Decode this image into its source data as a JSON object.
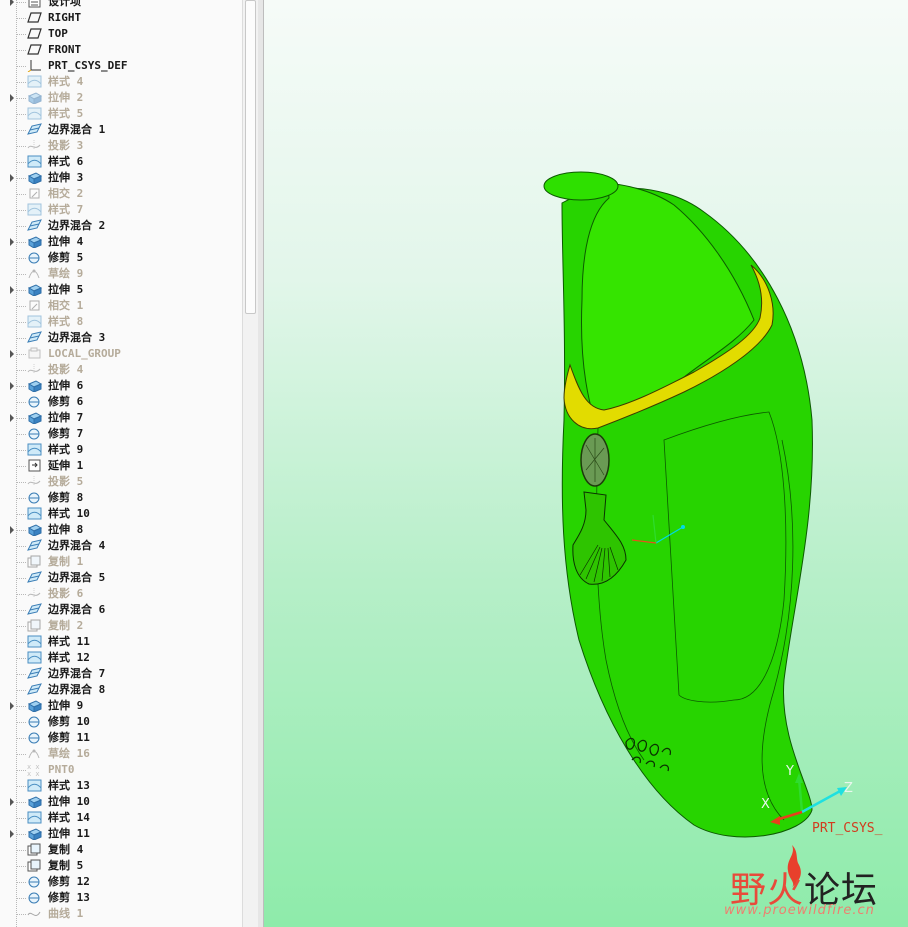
{
  "model_tree": {
    "items": [
      {
        "label": "设计项",
        "icon": "design-items-icon",
        "expander": true,
        "suppressed": false
      },
      {
        "label": "RIGHT",
        "icon": "datum-plane-icon",
        "expander": false,
        "suppressed": false
      },
      {
        "label": "TOP",
        "icon": "datum-plane-icon",
        "expander": false,
        "suppressed": false
      },
      {
        "label": "FRONT",
        "icon": "datum-plane-icon",
        "expander": false,
        "suppressed": false
      },
      {
        "label": "PRT_CSYS_DEF",
        "icon": "csys-icon",
        "expander": false,
        "suppressed": false
      },
      {
        "label": "样式 4",
        "icon": "style-icon",
        "expander": false,
        "suppressed": true
      },
      {
        "label": "拉伸 2",
        "icon": "extrude-icon",
        "expander": true,
        "suppressed": true
      },
      {
        "label": "样式 5",
        "icon": "style-icon",
        "expander": false,
        "suppressed": true
      },
      {
        "label": "边界混合 1",
        "icon": "boundary-blend-icon",
        "expander": false,
        "suppressed": false
      },
      {
        "label": "投影 3",
        "icon": "projection-icon",
        "expander": false,
        "suppressed": true
      },
      {
        "label": "样式 6",
        "icon": "style-icon",
        "expander": false,
        "suppressed": false
      },
      {
        "label": "拉伸 3",
        "icon": "extrude-icon",
        "expander": true,
        "suppressed": false
      },
      {
        "label": "相交 2",
        "icon": "intersect-icon",
        "expander": false,
        "suppressed": true
      },
      {
        "label": "样式 7",
        "icon": "style-icon",
        "expander": false,
        "suppressed": true
      },
      {
        "label": "边界混合 2",
        "icon": "boundary-blend-icon",
        "expander": false,
        "suppressed": false
      },
      {
        "label": "拉伸 4",
        "icon": "extrude-icon",
        "expander": true,
        "suppressed": false
      },
      {
        "label": "修剪 5",
        "icon": "trim-icon",
        "expander": false,
        "suppressed": false
      },
      {
        "label": "草绘 9",
        "icon": "sketch-icon",
        "expander": false,
        "suppressed": true
      },
      {
        "label": "拉伸 5",
        "icon": "extrude-icon",
        "expander": true,
        "suppressed": false
      },
      {
        "label": "相交 1",
        "icon": "intersect-icon",
        "expander": false,
        "suppressed": true
      },
      {
        "label": "样式 8",
        "icon": "style-icon",
        "expander": false,
        "suppressed": true
      },
      {
        "label": "边界混合 3",
        "icon": "boundary-blend-icon",
        "expander": false,
        "suppressed": false
      },
      {
        "label": "LOCAL_GROUP",
        "icon": "group-icon",
        "expander": true,
        "suppressed": true
      },
      {
        "label": "投影 4",
        "icon": "projection-icon",
        "expander": false,
        "suppressed": true
      },
      {
        "label": "拉伸 6",
        "icon": "extrude-icon",
        "expander": true,
        "suppressed": false
      },
      {
        "label": "修剪 6",
        "icon": "trim-icon",
        "expander": false,
        "suppressed": false
      },
      {
        "label": "拉伸 7",
        "icon": "extrude-icon",
        "expander": true,
        "suppressed": false
      },
      {
        "label": "修剪 7",
        "icon": "trim-icon",
        "expander": false,
        "suppressed": false
      },
      {
        "label": "样式 9",
        "icon": "style-icon",
        "expander": false,
        "suppressed": false
      },
      {
        "label": "延伸 1",
        "icon": "extend-icon",
        "expander": false,
        "suppressed": false
      },
      {
        "label": "投影 5",
        "icon": "projection-icon",
        "expander": false,
        "suppressed": true
      },
      {
        "label": "修剪 8",
        "icon": "trim-icon",
        "expander": false,
        "suppressed": false
      },
      {
        "label": "样式 10",
        "icon": "style-icon",
        "expander": false,
        "suppressed": false
      },
      {
        "label": "拉伸 8",
        "icon": "extrude-icon",
        "expander": true,
        "suppressed": false
      },
      {
        "label": "边界混合 4",
        "icon": "boundary-blend-icon",
        "expander": false,
        "suppressed": false
      },
      {
        "label": "复制 1",
        "icon": "copy-icon",
        "expander": false,
        "suppressed": true
      },
      {
        "label": "边界混合 5",
        "icon": "boundary-blend-icon",
        "expander": false,
        "suppressed": false
      },
      {
        "label": "投影 6",
        "icon": "projection-icon",
        "expander": false,
        "suppressed": true
      },
      {
        "label": "边界混合 6",
        "icon": "boundary-blend-icon",
        "expander": false,
        "suppressed": false
      },
      {
        "label": "复制 2",
        "icon": "copy-icon",
        "expander": false,
        "suppressed": true
      },
      {
        "label": "样式 11",
        "icon": "style-icon",
        "expander": false,
        "suppressed": false
      },
      {
        "label": "样式 12",
        "icon": "style-icon",
        "expander": false,
        "suppressed": false
      },
      {
        "label": "边界混合 7",
        "icon": "boundary-blend-icon",
        "expander": false,
        "suppressed": false
      },
      {
        "label": "边界混合 8",
        "icon": "boundary-blend-icon",
        "expander": false,
        "suppressed": false
      },
      {
        "label": "拉伸 9",
        "icon": "extrude-icon",
        "expander": true,
        "suppressed": false
      },
      {
        "label": "修剪 10",
        "icon": "trim-icon",
        "expander": false,
        "suppressed": false
      },
      {
        "label": "修剪 11",
        "icon": "trim-icon",
        "expander": false,
        "suppressed": false
      },
      {
        "label": "草绘 16",
        "icon": "sketch-icon",
        "expander": false,
        "suppressed": true
      },
      {
        "label": "PNT0",
        "icon": "datum-point-icon",
        "expander": false,
        "suppressed": true
      },
      {
        "label": "样式 13",
        "icon": "style-icon",
        "expander": false,
        "suppressed": false
      },
      {
        "label": "拉伸 10",
        "icon": "extrude-icon",
        "expander": true,
        "suppressed": false
      },
      {
        "label": "样式 14",
        "icon": "style-icon",
        "expander": false,
        "suppressed": false
      },
      {
        "label": "拉伸 11",
        "icon": "extrude-icon",
        "expander": true,
        "suppressed": false
      },
      {
        "label": "复制 4",
        "icon": "copy-icon",
        "expander": false,
        "suppressed": false
      },
      {
        "label": "复制 5",
        "icon": "copy-icon",
        "expander": false,
        "suppressed": false
      },
      {
        "label": "修剪 12",
        "icon": "trim-icon",
        "expander": false,
        "suppressed": false
      },
      {
        "label": "修剪 13",
        "icon": "trim-icon",
        "expander": false,
        "suppressed": false
      },
      {
        "label": "曲线 1",
        "icon": "curve-icon",
        "expander": false,
        "suppressed": true
      }
    ]
  },
  "viewport": {
    "csys_label": "PRT_CSYS_",
    "axis_labels": {
      "x": "X",
      "y": "Y",
      "z": "Z"
    },
    "colors": {
      "body": "#27d400",
      "collar": "#e2dc00",
      "background_bottom": "#8eebaa",
      "csys": "#d23b1e"
    }
  },
  "watermark": {
    "title_part1": "野火",
    "title_part2": "论坛",
    "url": "www.proewildfire.cn"
  }
}
